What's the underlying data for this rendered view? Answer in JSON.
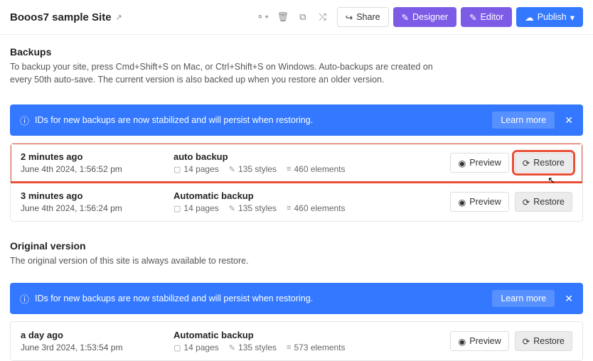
{
  "header": {
    "title": "Booos7 sample Site",
    "share": "Share",
    "designer": "Designer",
    "editor": "Editor",
    "publish": "Publish"
  },
  "backups": {
    "heading": "Backups",
    "desc": "To backup your site, press Cmd+Shift+S on Mac, or Ctrl+Shift+S on Windows. Auto-backups are created on every 50th auto-save. The current version is also backed up when you restore an older version."
  },
  "banner": {
    "text": "IDs for new backups are now stabilized and will persist when restoring.",
    "learn": "Learn more"
  },
  "rows": [
    {
      "rel": "2 minutes ago",
      "abs": "June 4th 2024, 1:56:52 pm",
      "title": "auto backup",
      "pages": "14 pages",
      "styles": "135 styles",
      "elements": "460 elements"
    },
    {
      "rel": "3 minutes ago",
      "abs": "June 4th 2024, 1:56:24 pm",
      "title": "Automatic backup",
      "pages": "14 pages",
      "styles": "135 styles",
      "elements": "460 elements"
    }
  ],
  "original": {
    "heading": "Original version",
    "desc": "The original version of this site is always available to restore."
  },
  "rows2": [
    {
      "rel": "a day ago",
      "abs": "June 3rd 2024, 1:53:54 pm",
      "title": "Automatic backup",
      "pages": "14 pages",
      "styles": "135 styles",
      "elements": "573 elements"
    }
  ],
  "actions": {
    "preview": "Preview",
    "restore": "Restore"
  }
}
